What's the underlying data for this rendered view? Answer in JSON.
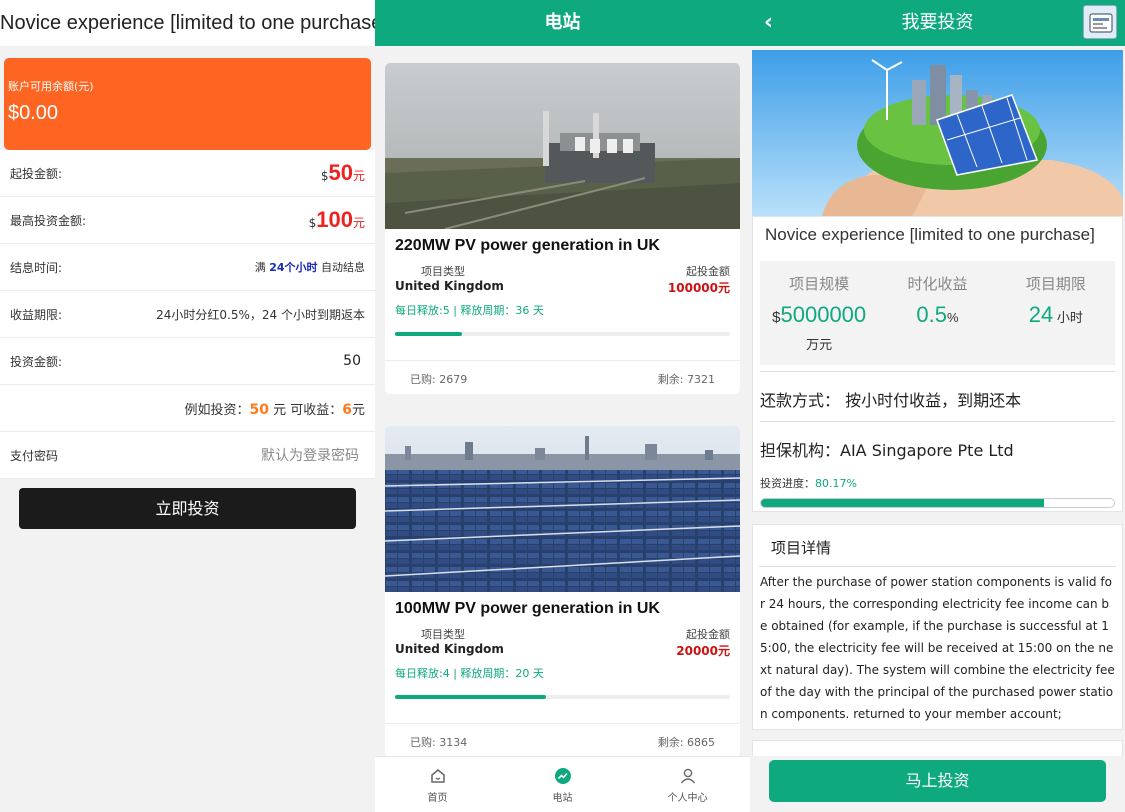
{
  "left_panel": {
    "title": "Novice experience [limited to one purchase]",
    "balance_label": "账户可用余额(元)",
    "balance_value": "$0.00",
    "rows": {
      "min_label": "起投金额:",
      "min_currency": "$",
      "min_value": "50",
      "min_unit": "元",
      "max_label": "最高投资金额:",
      "max_currency": "$",
      "max_value": "100",
      "max_unit": "元",
      "settle_label": "结息时间:",
      "settle_pre": "满 ",
      "settle_hours": "24个小时",
      "settle_post": " 自动结息",
      "period_label": "收益期限:",
      "period_value": "24小时分红0.5%，24 个小时到期返本",
      "amount_label": "投资金额:",
      "amount_value": "50",
      "example_pre": "例如投资：",
      "example_invest": "50",
      "example_mid": " 元 可收益：",
      "example_earn": "6",
      "example_unit": "元",
      "pwd_label": "支付密码",
      "pwd_placeholder": "默认为登录密码"
    },
    "invest_button": "立即投资"
  },
  "middle_panel": {
    "title": "电站",
    "cards": [
      {
        "title": "220MW PV power generation in UK",
        "type_label": "项目类型",
        "type_value": "United Kingdom",
        "min_label": "起投金额",
        "min_value": "100000元",
        "release": "每日释放:5 | 释放周期：36 天",
        "progress": 0.2,
        "bought": "已购: 2679",
        "remaining": "剩余: 7321"
      },
      {
        "title": "100MW PV power generation in UK",
        "type_label": "项目类型",
        "type_value": "United Kingdom",
        "min_label": "起投金额",
        "min_value": "20000元",
        "release": "每日释放:4 | 释放周期：20 天",
        "progress": 0.45,
        "bought": "已购: 3134",
        "remaining": "剩余: 6865"
      }
    ],
    "tabs": [
      {
        "label": "首页",
        "icon": "home-icon"
      },
      {
        "label": "电站",
        "icon": "station-icon"
      },
      {
        "label": "个人中心",
        "icon": "user-icon"
      }
    ],
    "accent": "#0fa97f"
  },
  "right_panel": {
    "title": "我要投资",
    "back_glyph": "‹",
    "project_name": "Novice experience [limited to one purchase]",
    "stats": {
      "scale_label": "项目规模",
      "scale_currency": "$",
      "scale_value": "5000000",
      "scale_unit": "万元",
      "yield_label": "时化收益",
      "yield_value": "0.5",
      "yield_unit": "%",
      "term_label": "项目期限",
      "term_value": "24",
      "term_unit": " 小时"
    },
    "repay_label": "还款方式：",
    "repay_value": "按小时付收益，到期还本",
    "guarantor_label": "担保机构：",
    "guarantor_value": "AIA Singapore Pte Ltd",
    "progress_label": "投资进度：",
    "progress_value": "80.17%",
    "progress": 0.8017,
    "details_title": "项目详情",
    "details_body": "After the purchase of power station components is valid for 24 hours, the corresponding electricity fee income can be obtained (for example, if the purchase is successful at 15:00, the electricity fee will be received at 15:00 on the next natural day). The system will combine the electricity fee of the day with the principal of the purchased power station components. returned to your member account;",
    "go_button": "马上投资"
  }
}
